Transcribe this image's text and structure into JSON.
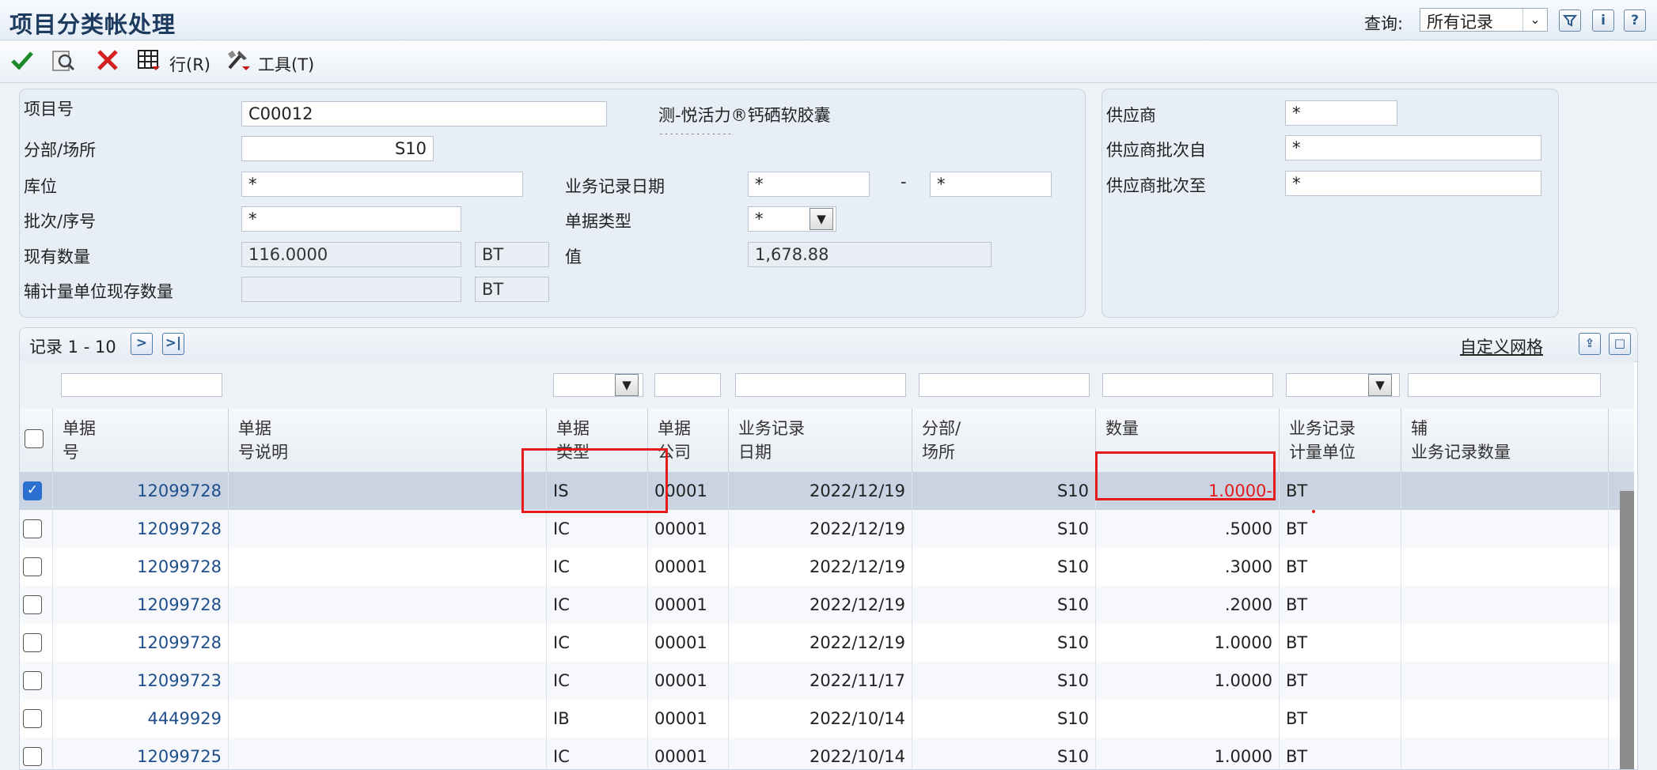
{
  "app": {
    "title": "项目分类帐处理",
    "query_label": "查询:",
    "query_value": "所有记录"
  },
  "toolbar": {
    "row_menu": "行(R)",
    "tools_menu": "工具(T)"
  },
  "header": {
    "item_no_label": "项目号",
    "item_no_value": "C00012",
    "item_desc": "测-悦活力®钙硒软胶囊",
    "item_desc2": "..............",
    "branch_label": "分部/场所",
    "branch_value": "S10",
    "location_label": "库位",
    "location_value": "*",
    "lot_label": "批次/序号",
    "lot_value": "*",
    "onhand_label": "现有数量",
    "onhand_value": "116.0000",
    "onhand_uom": "BT",
    "secondary_label": "辅计量单位现存数量",
    "secondary_value": "",
    "secondary_uom": "BT",
    "trans_date_label": "业务记录日期",
    "trans_date_from": "*",
    "trans_date_sep": "-",
    "trans_date_to": "*",
    "doc_type_label": "单据类型",
    "doc_type_value": "*",
    "value_label": "值",
    "value_value": "1,678.88"
  },
  "supplier": {
    "supplier_label": "供应商",
    "supplier_value": "*",
    "lot_from_label": "供应商批次自",
    "lot_from_value": "*",
    "lot_to_label": "供应商批次至",
    "lot_to_value": "*"
  },
  "grid": {
    "records_label": "记录 1 - 10",
    "custom_grid": "自定义网格",
    "columns": [
      {
        "l1": "单据",
        "l2": "号"
      },
      {
        "l1": "单据",
        "l2": "号说明"
      },
      {
        "l1": "单据",
        "l2": "类型"
      },
      {
        "l1": "单据",
        "l2": "公司"
      },
      {
        "l1": "业务记录",
        "l2": "日期"
      },
      {
        "l1": "分部/",
        "l2": "场所"
      },
      {
        "l1": "",
        "l2": "数量"
      },
      {
        "l1": "业务记录",
        "l2": "计量单位"
      },
      {
        "l1": "辅",
        "l2": "业务记录数量"
      }
    ],
    "rows": [
      {
        "doc": "12099728",
        "desc": "",
        "type": "IS",
        "co": "00001",
        "date": "2022/12/19",
        "branch": "S10",
        "qty": "1.0000-",
        "uom": "BT",
        "sec": ""
      },
      {
        "doc": "12099728",
        "desc": "",
        "type": "IC",
        "co": "00001",
        "date": "2022/12/19",
        "branch": "S10",
        "qty": ".5000",
        "uom": "BT",
        "sec": ""
      },
      {
        "doc": "12099728",
        "desc": "",
        "type": "IC",
        "co": "00001",
        "date": "2022/12/19",
        "branch": "S10",
        "qty": ".3000",
        "uom": "BT",
        "sec": ""
      },
      {
        "doc": "12099728",
        "desc": "",
        "type": "IC",
        "co": "00001",
        "date": "2022/12/19",
        "branch": "S10",
        "qty": ".2000",
        "uom": "BT",
        "sec": ""
      },
      {
        "doc": "12099728",
        "desc": "",
        "type": "IC",
        "co": "00001",
        "date": "2022/12/19",
        "branch": "S10",
        "qty": "1.0000",
        "uom": "BT",
        "sec": ""
      },
      {
        "doc": "12099723",
        "desc": "",
        "type": "IC",
        "co": "00001",
        "date": "2022/11/17",
        "branch": "S10",
        "qty": "1.0000",
        "uom": "BT",
        "sec": ""
      },
      {
        "doc": "4449929",
        "desc": "",
        "type": "IB",
        "co": "00001",
        "date": "2022/10/14",
        "branch": "S10",
        "qty": "",
        "uom": "BT",
        "sec": ""
      },
      {
        "doc": "12099725",
        "desc": "",
        "type": "IC",
        "co": "00001",
        "date": "2022/10/14",
        "branch": "S10",
        "qty": "1.0000",
        "uom": "BT",
        "sec": ""
      }
    ]
  },
  "colors": {
    "selected_row": "#c9d3e1",
    "link": "#1f4e8c",
    "negative": "#e31b1b",
    "highlight_box": "#e31b1b"
  }
}
